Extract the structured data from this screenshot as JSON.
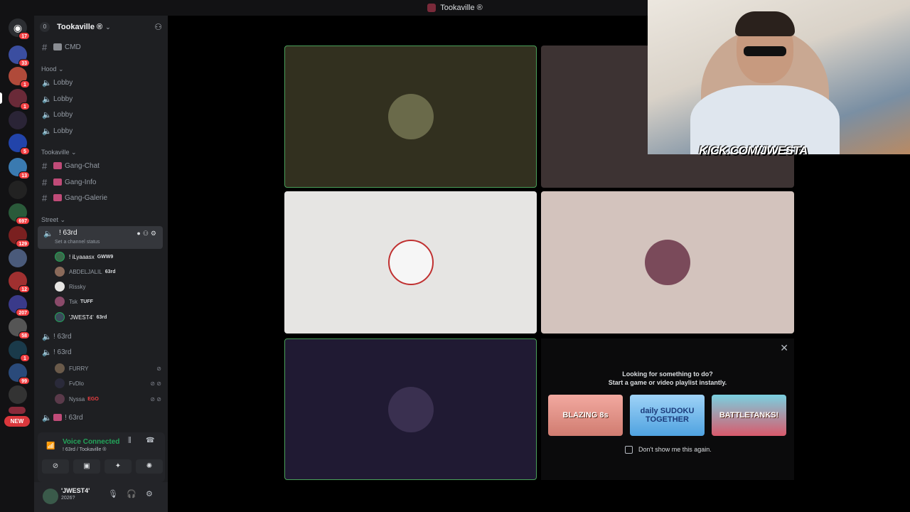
{
  "window": {
    "title": "Tookaville ®"
  },
  "server": {
    "name": "Tookaville ®",
    "count": "0"
  },
  "rail": {
    "badges": [
      "17",
      "33",
      "1",
      "1",
      "5",
      "13",
      "697",
      "129",
      "12",
      "207",
      "58",
      "1",
      "99"
    ],
    "new_label": "NEW"
  },
  "sidebar": {
    "top_channel": "CMD",
    "cat_hood": "Hood",
    "hood_channels": [
      "Lobby",
      "Lobby",
      "Lobby",
      "Lobby"
    ],
    "cat_tookaville": "Tookaville",
    "tookaville_channels": [
      "Gang-Chat",
      "Gang-Info",
      "Gang-Galerie"
    ],
    "cat_street": "Street",
    "active_channel": "! 63rd",
    "active_status": "Set a channel status",
    "voice_users": [
      {
        "name": "! iLyaaasx",
        "tag": "GWW9"
      },
      {
        "name": "ABDELJALIL",
        "tag": "63rd"
      },
      {
        "name": "Rissky",
        "tag": ""
      },
      {
        "name": "Tsk",
        "tag": "TUFF"
      },
      {
        "name": "'JWEST4'",
        "tag": "63rd"
      }
    ],
    "ch2": "! 63rd",
    "ch3": "! 63rd",
    "ch3_users": [
      {
        "name": "FURRY",
        "tag": ""
      },
      {
        "name": "FvDlo",
        "tag": ""
      },
      {
        "name": "Nyssa",
        "tag": "EGO"
      }
    ],
    "ch4": "! 63rd"
  },
  "voice_panel": {
    "status": "Voice Connected",
    "location": "! 63rd / Tookaville ®"
  },
  "user": {
    "name": "'JWEST4'",
    "status": "2026?"
  },
  "promo": {
    "line1": "Looking for something to do?",
    "line2": "Start a game or video playlist instantly.",
    "games": [
      "BLAZING 8s",
      "daily SUDOKU TOGETHER",
      "BATTLETANKS!"
    ],
    "checkbox_label": "Don't show me this again."
  },
  "overlay": {
    "kick_text": "KICK.COM/JWESTA"
  }
}
